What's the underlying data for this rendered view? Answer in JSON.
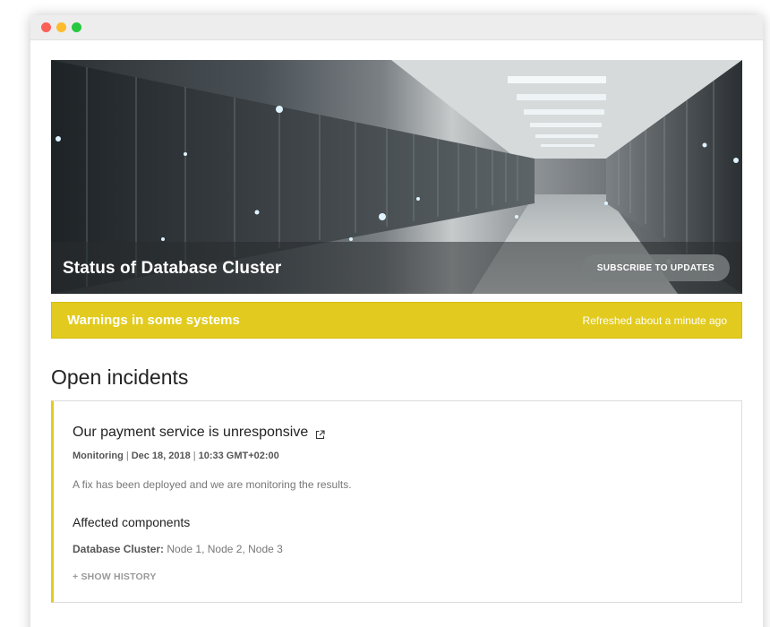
{
  "window": {
    "controls": [
      "close",
      "minimize",
      "maximize"
    ]
  },
  "hero": {
    "title": "Status of Database Cluster",
    "subscribe_label": "SUBSCRIBE TO UPDATES",
    "image": "server-room-photo"
  },
  "status": {
    "message": "Warnings in some systems",
    "refreshed": "Refreshed about a minute ago",
    "color": "#e2cb1e"
  },
  "incidents": {
    "heading": "Open incidents",
    "items": [
      {
        "title": "Our payment service is unresponsive",
        "title_icon": "external-link-icon",
        "status": "Monitoring",
        "date": "Dec 18, 2018",
        "time": "10:33 GMT+02:00",
        "description": "A fix has been deployed and we are monitoring the results.",
        "affected_heading": "Affected components",
        "affected_group": "Database Cluster:",
        "affected_nodes": "Node 1, Node 2, Node 3",
        "history_label": "+ SHOW HISTORY"
      }
    ]
  }
}
